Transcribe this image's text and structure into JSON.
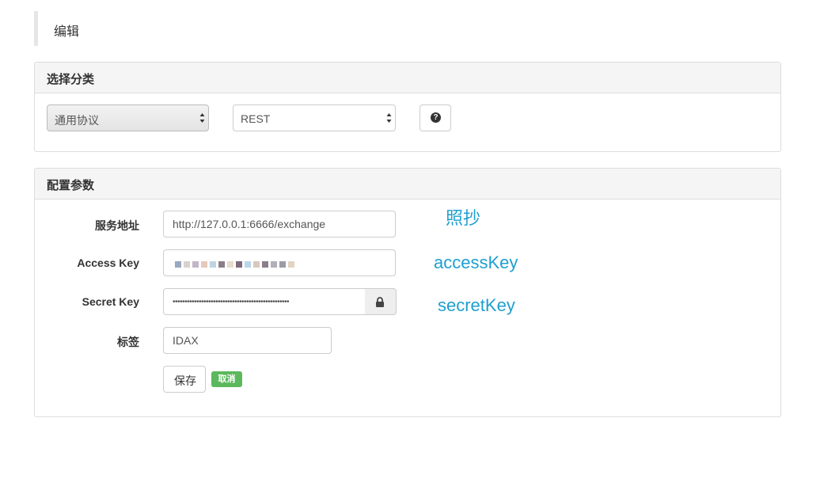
{
  "header": {
    "title": "编辑"
  },
  "category_panel": {
    "title": "选择分类",
    "protocol_select": {
      "value": "通用协议"
    },
    "type_select": {
      "value": "REST"
    },
    "help_button": {
      "icon": "question-circle-icon",
      "glyph": "?"
    }
  },
  "config_panel": {
    "title": "配置参数",
    "fields": {
      "service_address": {
        "label": "服务地址",
        "value": "http://127.0.0.1:6666/exchange"
      },
      "access_key": {
        "label": "Access Key",
        "value": ""
      },
      "secret_key": {
        "label": "Secret Key",
        "value": "•••••••••••••••••••••••••••••••••••••••••••••••••",
        "icon": "lock-icon"
      },
      "tag": {
        "label": "标签",
        "value": "IDAX"
      }
    },
    "buttons": {
      "save": "保存",
      "cancel": "取消"
    },
    "annotations": {
      "copy": "照抄",
      "access_key": "accessKey",
      "secret_key": "secretKey"
    }
  },
  "colors": {
    "annotation": "#1e9fd0",
    "cancel_button": "#5cb85c",
    "panel_heading": "#f5f5f5"
  }
}
